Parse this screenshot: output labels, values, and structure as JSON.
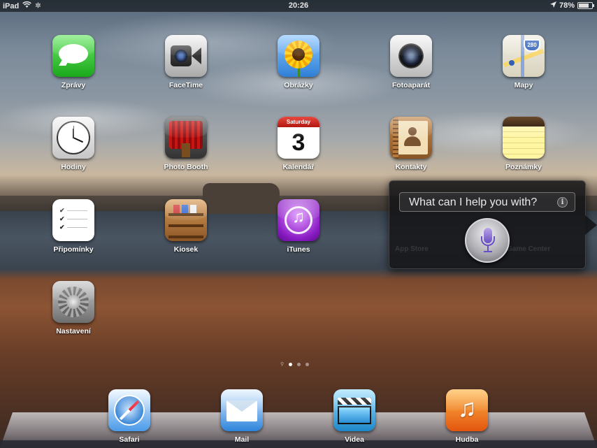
{
  "status_bar": {
    "device": "iPad",
    "time": "20:26",
    "battery": "78%",
    "battery_level": 0.78,
    "icons": [
      "wifi-icon",
      "activity-spinner-icon",
      "location-arrow-icon",
      "battery-icon"
    ]
  },
  "home_screen": {
    "apps": [
      {
        "label": "Zprávy",
        "icon": "messages-icon"
      },
      {
        "label": "FaceTime",
        "icon": "facetime-icon"
      },
      {
        "label": "Obrázky",
        "icon": "photos-icon"
      },
      {
        "label": "Fotoaparát",
        "icon": "camera-icon"
      },
      {
        "label": "Mapy",
        "icon": "maps-icon",
        "badge_text": "280"
      },
      {
        "label": "Hodiny",
        "icon": "clock-icon"
      },
      {
        "label": "Photo Booth",
        "icon": "photo-booth-icon"
      },
      {
        "label": "Kalendář",
        "icon": "calendar-icon",
        "weekday": "Saturday",
        "day": "3"
      },
      {
        "label": "Kontakty",
        "icon": "contacts-icon"
      },
      {
        "label": "Poznámky",
        "icon": "notes-icon"
      },
      {
        "label": "Připomínky",
        "icon": "reminders-icon"
      },
      {
        "label": "Kiosek",
        "icon": "newsstand-icon"
      },
      {
        "label": "iTunes",
        "icon": "itunes-icon"
      },
      {
        "label": "Nastavení",
        "icon": "settings-icon"
      }
    ],
    "page_indicator": {
      "pages": 3,
      "current": 1,
      "has_spotlight": true
    }
  },
  "dock": {
    "apps": [
      {
        "label": "Safari",
        "icon": "safari-icon"
      },
      {
        "label": "Mail",
        "icon": "mail-icon"
      },
      {
        "label": "Videa",
        "icon": "videos-icon"
      },
      {
        "label": "Hudba",
        "icon": "music-icon"
      }
    ]
  },
  "siri": {
    "prompt": "What can I help you with?",
    "info_glyph": "i",
    "mic_icon": "microphone-icon",
    "ghost_labels": [
      "App Store",
      "Game Center"
    ]
  },
  "colors": {
    "siri_panel": "#141416",
    "statusbar_bg": "#000000",
    "label_text": "#ffffff"
  }
}
